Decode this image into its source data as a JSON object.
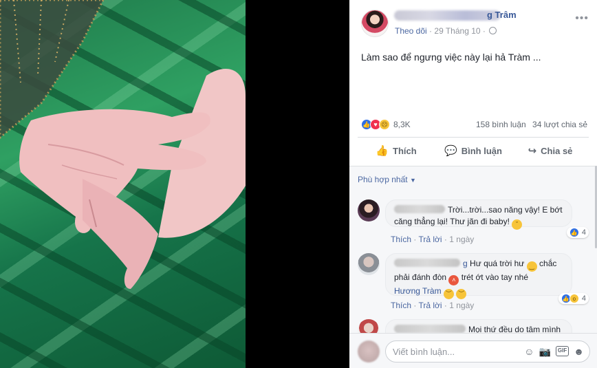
{
  "post": {
    "author_name_tail": "g Trâm",
    "follow_label": "Theo dõi",
    "date": "29 Tháng 10",
    "text": "Làm sao để ngưng việc này lại hả Tràm ...",
    "reaction_count": "8,3K",
    "comment_count": "158 bình luận",
    "share_count": "34 lượt chia sẻ",
    "actions": {
      "like": "Thích",
      "comment": "Bình luận",
      "share": "Chia sẻ"
    }
  },
  "comments_sort": "Phù hợp nhất",
  "comments": [
    {
      "text_line1": "Trời...trời...sao năng vậy! E bớt",
      "text_line2": "căng thẳng lại! Thư jãn đi baby!",
      "like_label": "Thích",
      "reply_label": "Trả lời",
      "time": "1 ngày",
      "reaction_count": "4"
    },
    {
      "name_tail": "g",
      "text_part1": "Hư quá trời hư",
      "text_part2": "chắc",
      "text_part3": "phải đánh đòn",
      "text_part4": "trét ớt vào tay nhé",
      "tag": "Hương Tràm",
      "like_label": "Thích",
      "reply_label": "Trả lời",
      "time": "1 ngày",
      "reaction_count": "4"
    },
    {
      "text_line1": "Mọi thứ đều do tâm mình"
    }
  ],
  "compose": {
    "placeholder": "Viết bình luận..."
  },
  "icons": {
    "post_menu": "more-options-icon",
    "privacy": "globe-icon",
    "like": "thumbs-up-icon",
    "comment": "speech-bubble-icon",
    "share": "share-arrow-icon",
    "sort": "caret-down-icon",
    "compose": [
      "emoji-icon",
      "camera-icon",
      "gif-icon",
      "sticker-icon"
    ]
  },
  "colors": {
    "link_blue": "#385898",
    "like_blue": "#2e6fe6",
    "love_red": "#f0314f",
    "sad_yellow": "#f7c43a",
    "photo_green": "#1f7a4b"
  }
}
